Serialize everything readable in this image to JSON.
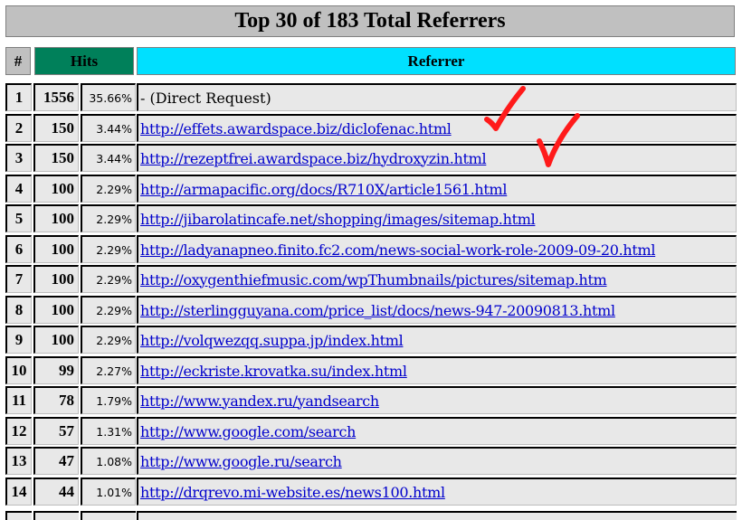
{
  "title": "Top 30 of 183 Total Referrers",
  "headers": {
    "num": "#",
    "hits": "Hits",
    "referrer": "Referrer"
  },
  "rows": [
    {
      "num": "1",
      "hits": "1556",
      "pct": "35.66%",
      "ref": "- (Direct Request)",
      "link": false
    },
    {
      "num": "2",
      "hits": "150",
      "pct": "3.44%",
      "ref": "http://effets.awardspace.biz/diclofenac.html",
      "link": true
    },
    {
      "num": "3",
      "hits": "150",
      "pct": "3.44%",
      "ref": "http://rezeptfrei.awardspace.biz/hydroxyzin.html",
      "link": true
    },
    {
      "num": "4",
      "hits": "100",
      "pct": "2.29%",
      "ref": "http://armapacific.org/docs/R710X/article1561.html",
      "link": true
    },
    {
      "num": "5",
      "hits": "100",
      "pct": "2.29%",
      "ref": "http://jibarolatincafe.net/shopping/images/sitemap.html",
      "link": true
    },
    {
      "num": "6",
      "hits": "100",
      "pct": "2.29%",
      "ref": "http://ladyanapneo.finito.fc2.com/news-social-work-role-2009-09-20.html",
      "link": true
    },
    {
      "num": "7",
      "hits": "100",
      "pct": "2.29%",
      "ref": "http://oxygenthiefmusic.com/wpThumbnails/pictures/sitemap.htm",
      "link": true
    },
    {
      "num": "8",
      "hits": "100",
      "pct": "2.29%",
      "ref": "http://sterlingguyana.com/price_list/docs/news-947-20090813.html",
      "link": true
    },
    {
      "num": "9",
      "hits": "100",
      "pct": "2.29%",
      "ref": "http://volqwezqq.suppa.jp/index.html",
      "link": true
    },
    {
      "num": "10",
      "hits": "99",
      "pct": "2.27%",
      "ref": "http://eckriste.krovatka.su/index.html",
      "link": true
    },
    {
      "num": "11",
      "hits": "78",
      "pct": "1.79%",
      "ref": "http://www.yandex.ru/yandsearch",
      "link": true
    },
    {
      "num": "12",
      "hits": "57",
      "pct": "1.31%",
      "ref": "http://www.google.com/search",
      "link": true
    },
    {
      "num": "13",
      "hits": "47",
      "pct": "1.08%",
      "ref": "http://www.google.ru/search",
      "link": true
    },
    {
      "num": "14",
      "hits": "44",
      "pct": "1.01%",
      "ref": "http://drqrevo.mi-website.es/news100.html",
      "link": true
    }
  ],
  "annotations": {
    "checkmark_color": "#ff0000",
    "icon": "checkmark-icon"
  },
  "colors": {
    "hits_header": "#00805a",
    "referrer_header": "#00e0ff",
    "link": "#0000cc"
  }
}
